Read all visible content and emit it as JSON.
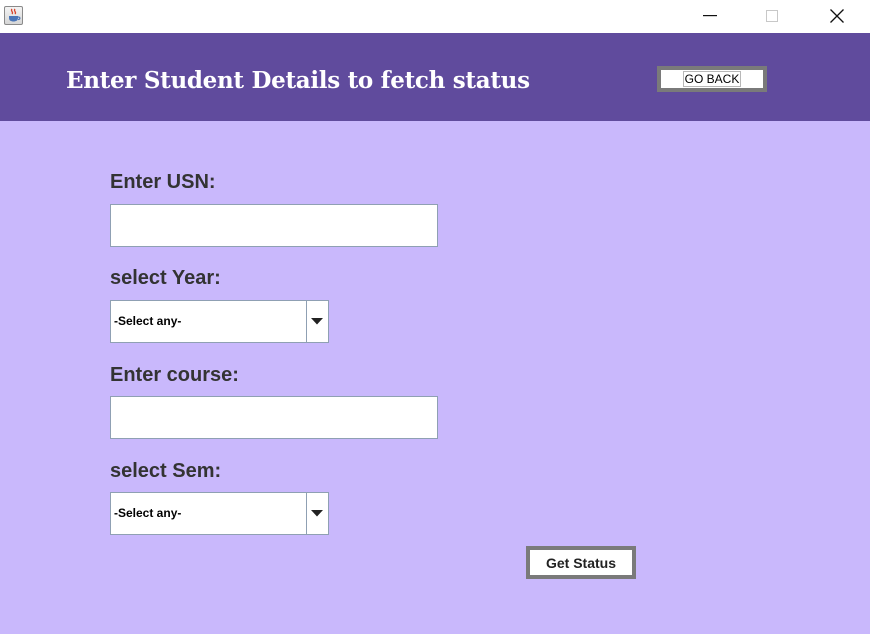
{
  "window": {
    "controls": {
      "minimize_icon": "minimize-icon",
      "maximize_icon": "maximize-icon",
      "close_icon": "close-icon"
    },
    "app_icon": "java-cup-icon"
  },
  "header": {
    "title": "Enter Student Details to fetch status",
    "go_back_label": "GO BACK",
    "background": "#604b9d"
  },
  "form": {
    "background": "#c9b8fc",
    "usn": {
      "label": "Enter USN:",
      "value": ""
    },
    "year": {
      "label": "select Year:",
      "selected": "-Select any-"
    },
    "course": {
      "label": "Enter course:",
      "value": ""
    },
    "sem": {
      "label": "select Sem:",
      "selected": "-Select any-"
    },
    "submit_label": "Get Status"
  }
}
